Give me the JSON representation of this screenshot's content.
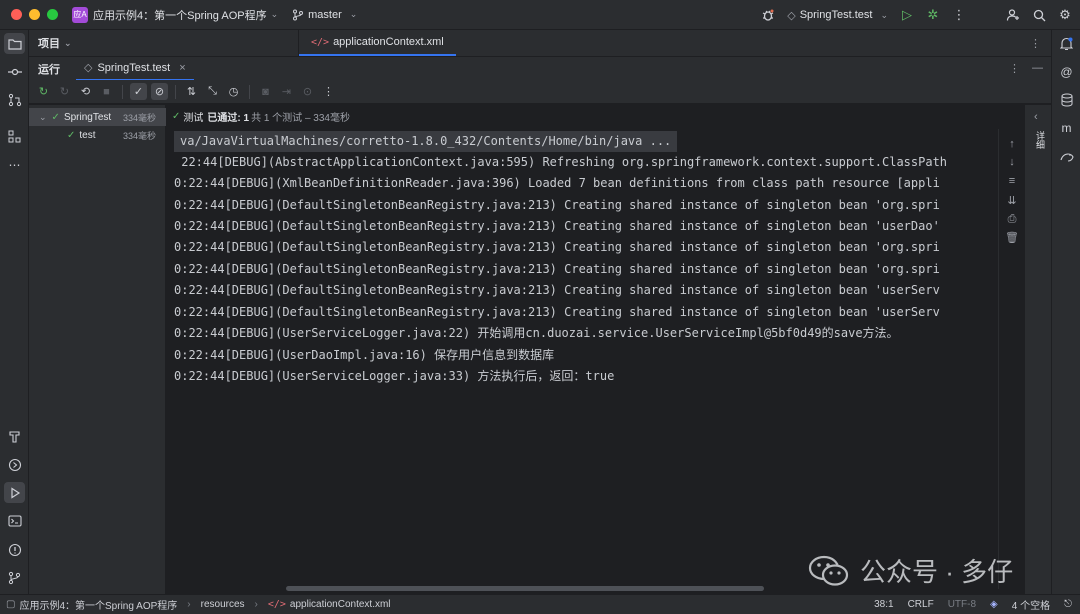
{
  "titlebar": {
    "project_badge": "应A",
    "project_name": "应用示例4：第一个Spring AOP程序",
    "branch": "master",
    "run_config": "SpringTest.test"
  },
  "project_panel": {
    "title": "项目"
  },
  "editor": {
    "tabs": [
      {
        "label": "applicationContext.xml"
      }
    ]
  },
  "run_window": {
    "title": "运行",
    "tab_label": "SpringTest.test"
  },
  "tree": {
    "items": [
      {
        "label": "SpringTest",
        "duration": "334毫秒"
      },
      {
        "label": "test",
        "duration": "334毫秒"
      }
    ]
  },
  "console": {
    "status_prefix": "测试",
    "status_passed": "已通过: 1",
    "status_detail": "共 1 个测试 – 334毫秒",
    "lines": [
      "va/JavaVirtualMachines/corretto-1.8.0_432/Contents/Home/bin/java ...",
      " 22:44[DEBUG](AbstractApplicationContext.java:595) Refreshing org.springframework.context.support.ClassPath",
      "0:22:44[DEBUG](XmlBeanDefinitionReader.java:396) Loaded 7 bean definitions from class path resource [appli",
      "0:22:44[DEBUG](DefaultSingletonBeanRegistry.java:213) Creating shared instance of singleton bean 'org.spri",
      "0:22:44[DEBUG](DefaultSingletonBeanRegistry.java:213) Creating shared instance of singleton bean 'userDao'",
      "0:22:44[DEBUG](DefaultSingletonBeanRegistry.java:213) Creating shared instance of singleton bean 'org.spri",
      "0:22:44[DEBUG](DefaultSingletonBeanRegistry.java:213) Creating shared instance of singleton bean 'org.spri",
      "0:22:44[DEBUG](DefaultSingletonBeanRegistry.java:213) Creating shared instance of singleton bean 'userServ",
      "0:22:44[DEBUG](DefaultSingletonBeanRegistry.java:213) Creating shared instance of singleton bean 'userServ",
      "0:22:44[DEBUG](UserServiceLogger.java:22) 开始调用cn.duozai.service.UserServiceImpl@5bf0d49的save方法。",
      "0:22:44[DEBUG](UserDaoImpl.java:16) 保存用户信息到数据库",
      "0:22:44[DEBUG](UserServiceLogger.java:33) 方法执行后，返回：true"
    ]
  },
  "side_panel": {
    "label": "详细"
  },
  "statusbar": {
    "breadcrumbs": [
      "应用示例4：第一个Spring AOP程序",
      "resources",
      "applicationContext.xml"
    ],
    "position": "38:1",
    "line_ending": "CRLF",
    "encoding": "UTF-8",
    "indent": "4 个空格"
  },
  "watermark": {
    "text": "公众号 · 多仔"
  },
  "colors": {
    "accent": "#3574f0",
    "pass": "#5fb865",
    "background": "#1e1f22",
    "panel": "#2b2d30"
  }
}
